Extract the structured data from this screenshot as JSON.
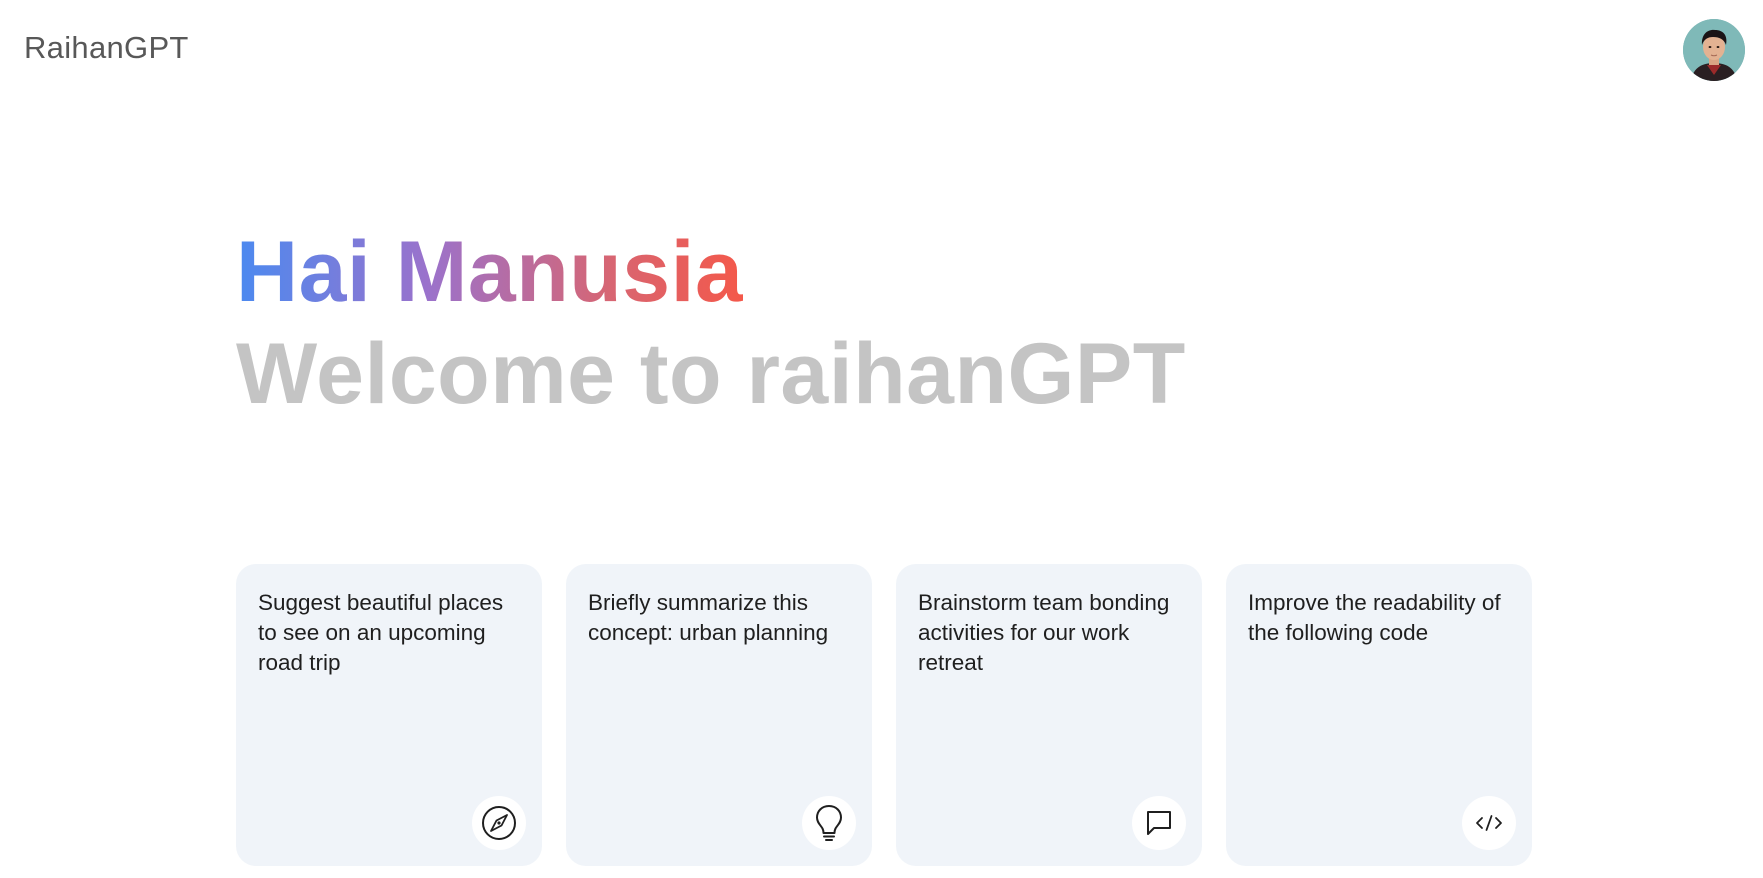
{
  "header": {
    "brand": "RaihanGPT",
    "avatar_icon": "user-avatar"
  },
  "hero": {
    "greeting": "Hai Manusia",
    "welcome": "Welcome to raihanGPT",
    "gradient_colors": [
      "#4b8af0",
      "#9b72cb",
      "#d96570",
      "#f4584a"
    ],
    "welcome_color": "#c4c4c4"
  },
  "cards": [
    {
      "text": "Suggest beautiful places to see on an upcoming road trip",
      "icon": "compass-icon"
    },
    {
      "text": "Briefly summarize this concept: urban planning",
      "icon": "lightbulb-icon"
    },
    {
      "text": "Brainstorm team bonding activities for our work retreat",
      "icon": "chat-bubble-icon"
    },
    {
      "text": "Improve the readability of the following code",
      "icon": "code-icon"
    }
  ],
  "colors": {
    "card_background": "#f0f4f9",
    "text": "#1f1f1f",
    "brand": "#585858"
  }
}
